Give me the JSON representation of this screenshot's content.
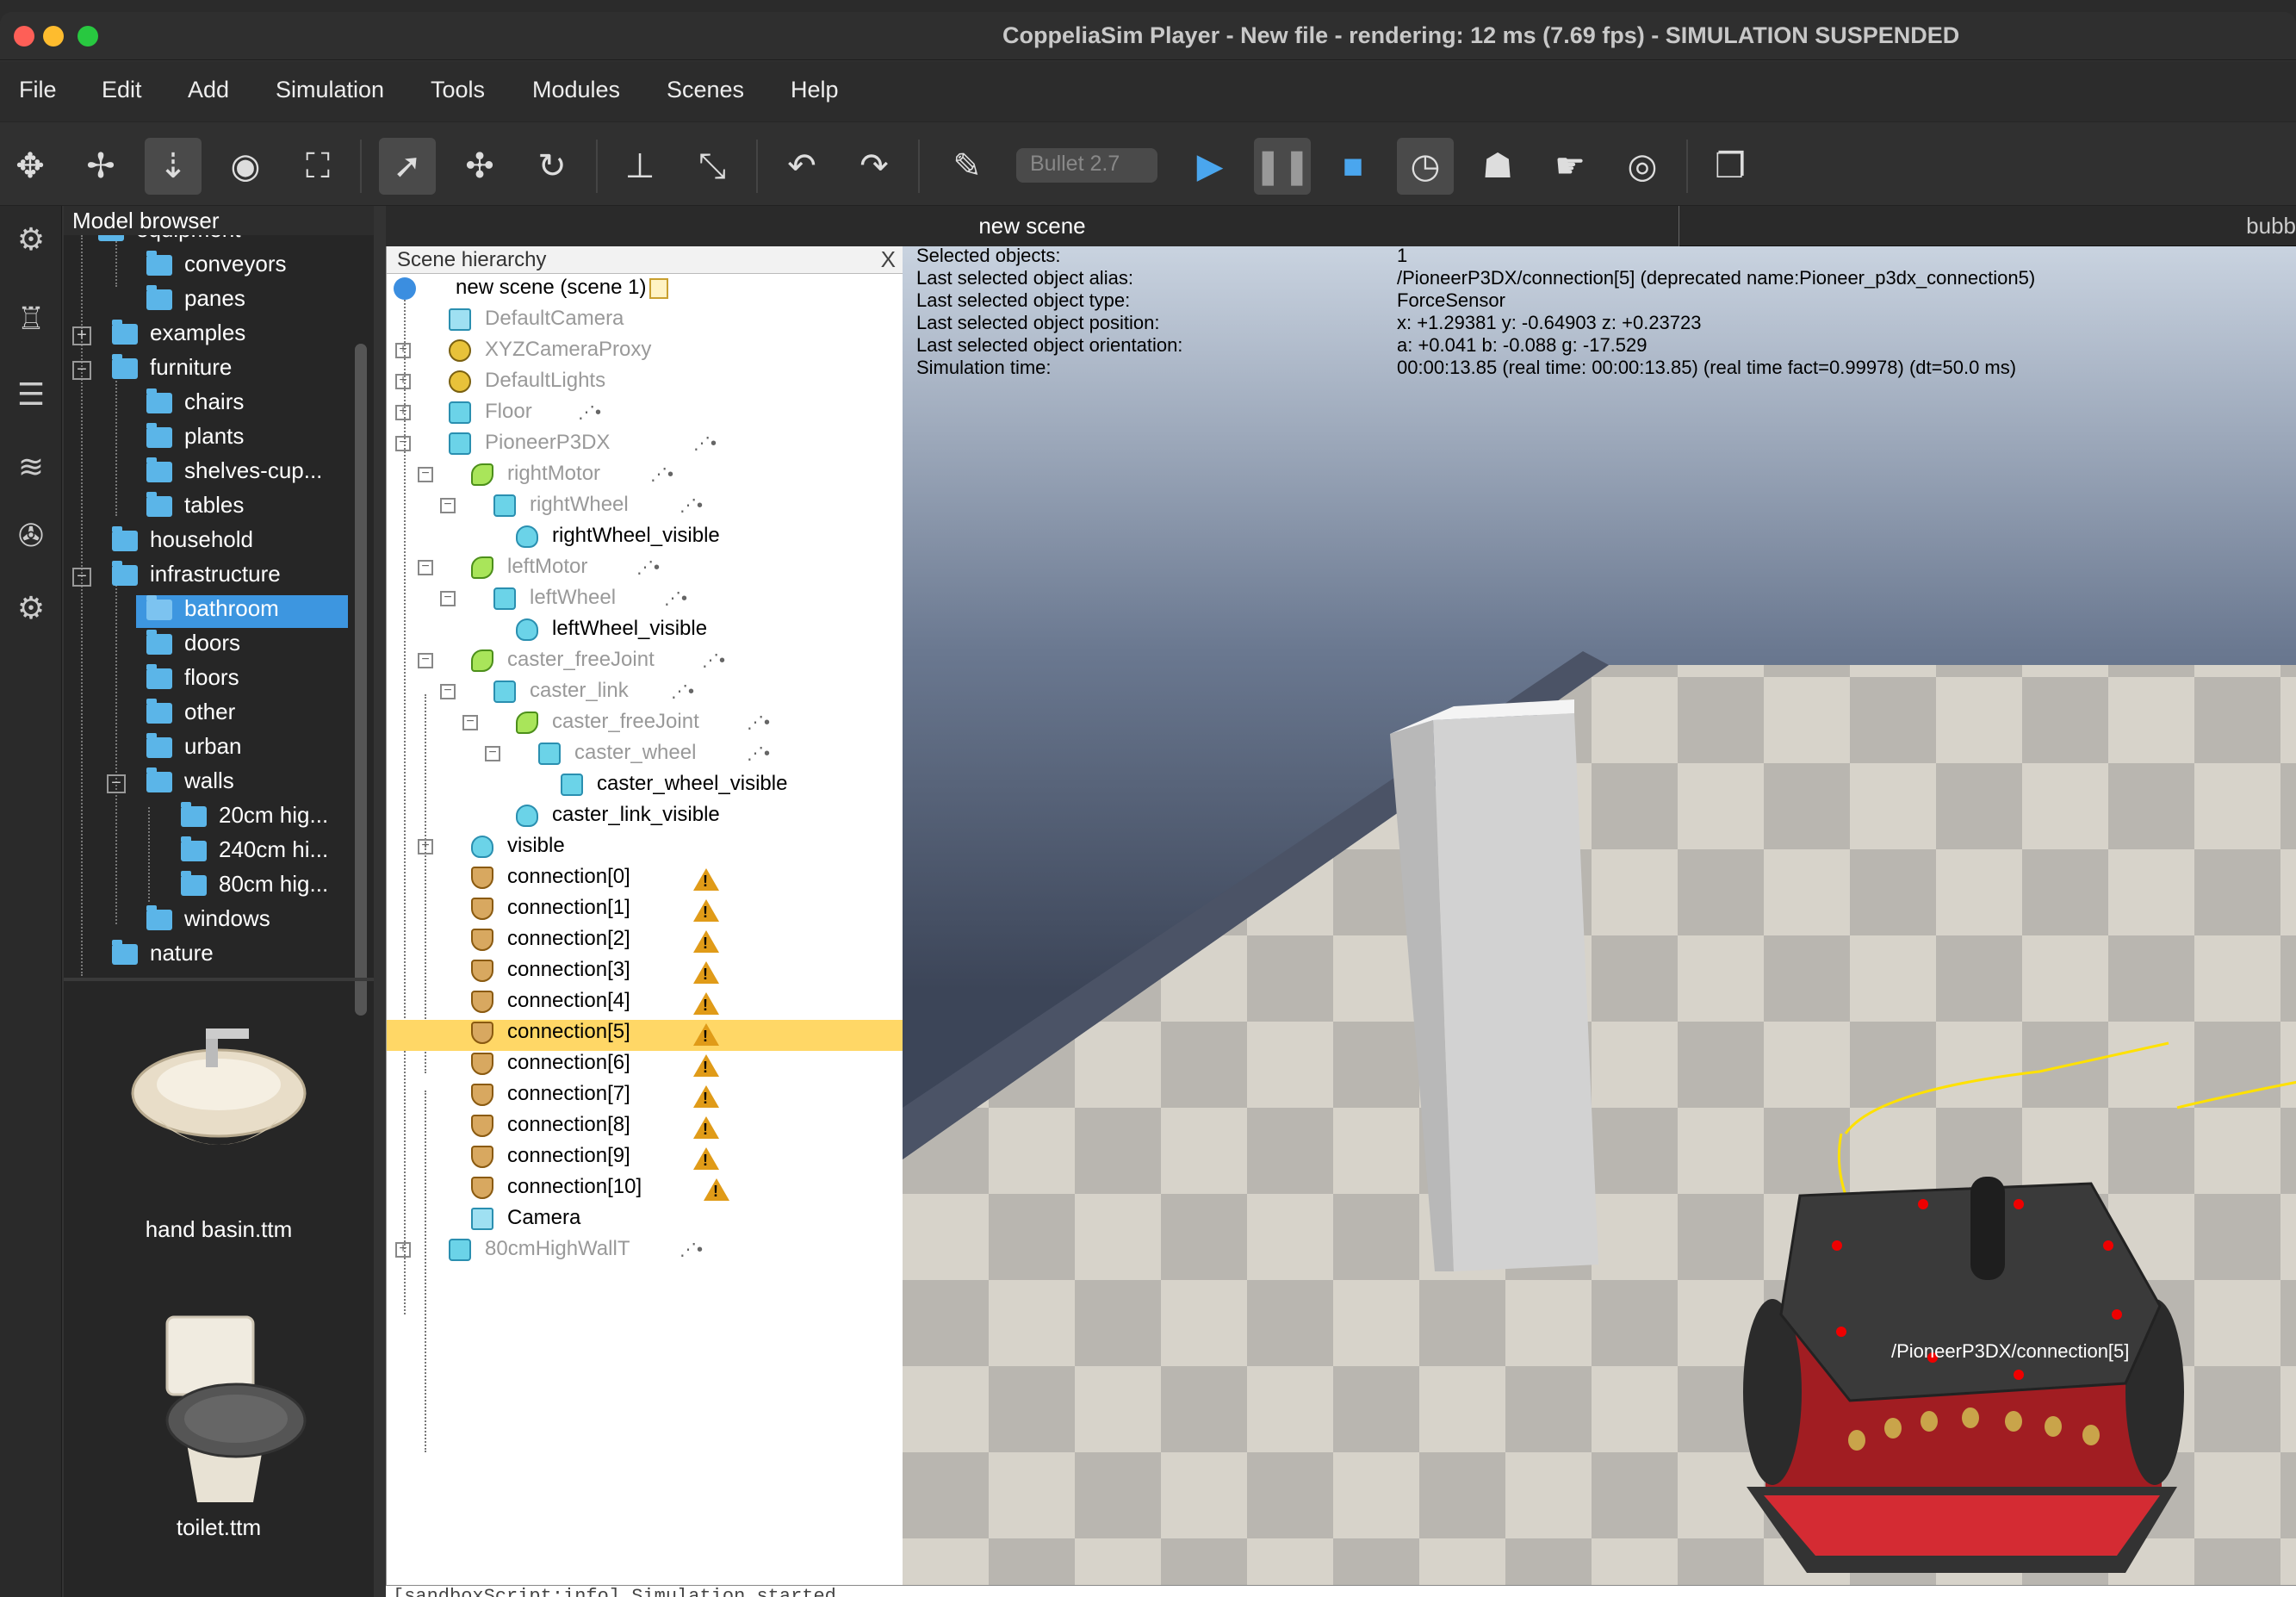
{
  "window": {
    "title": "CoppeliaSim Player - New file - rendering: 12 ms (7.69 fps) - SIMULATION SUSPENDED"
  },
  "menu": [
    "File",
    "Edit",
    "Add",
    "Simulation",
    "Tools",
    "Modules",
    "Scenes",
    "Help"
  ],
  "toolbar": {
    "engine": "Bullet 2.7"
  },
  "model_browser": {
    "title": "Model browser",
    "tree": [
      "equipment",
      "conveyors",
      "panes",
      "examples",
      "furniture",
      "chairs",
      "plants",
      "shelves-cup...",
      "tables",
      "household",
      "infrastructure",
      "bathroom",
      "doors",
      "floors",
      "other",
      "urban",
      "walls",
      "20cm hig...",
      "240cm hi...",
      "80cm hig...",
      "windows",
      "nature"
    ],
    "thumbnails": [
      "hand basin.ttm",
      "toilet.ttm"
    ]
  },
  "scene_hierarchy": {
    "title": "Scene hierarchy",
    "close": "X",
    "items": [
      "new scene (scene 1)",
      "DefaultCamera",
      "XYZCameraProxy",
      "DefaultLights",
      "Floor",
      "PioneerP3DX",
      "rightMotor",
      "rightWheel",
      "rightWheel_visible",
      "leftMotor",
      "leftWheel",
      "leftWheel_visible",
      "caster_freeJoint",
      "caster_link",
      "caster_freeJoint",
      "caster_wheel",
      "caster_wheel_visible",
      "caster_link_visible",
      "visible",
      "connection[0]",
      "connection[1]",
      "connection[2]",
      "connection[3]",
      "connection[4]",
      "connection[5]",
      "connection[6]",
      "connection[7]",
      "connection[8]",
      "connection[9]",
      "connection[10]",
      "Camera",
      "80cmHighWallT"
    ]
  },
  "tabs": [
    "new scene",
    "bubb"
  ],
  "info": {
    "labels": [
      "Selected objects:",
      "Last selected object alias:",
      "Last selected object type:",
      "Last selected object position:",
      "Last selected object orientation:",
      "Simulation time:"
    ],
    "values": [
      "1",
      "/PioneerP3DX/connection[5]    (deprecated name:Pioneer_p3dx_connection5)",
      "ForceSensor",
      "x: +1.29381    y: -0.64903    z: +0.23723",
      "a: +0.041    b: -0.088    g: -17.529",
      "00:00:13.85 (real time: 00:00:13.85) (real time fact=0.99978) (dt=50.0 ms)"
    ]
  },
  "viewport": {
    "object_label": "/PioneerP3DX/connection[5]"
  },
  "console": {
    "line": "[sandboxScript:info] Simulation started"
  },
  "colors": {
    "selection_tree": "#3d96e0",
    "selection_hierarchy": "#ffd766",
    "warning": "#e09b18"
  }
}
